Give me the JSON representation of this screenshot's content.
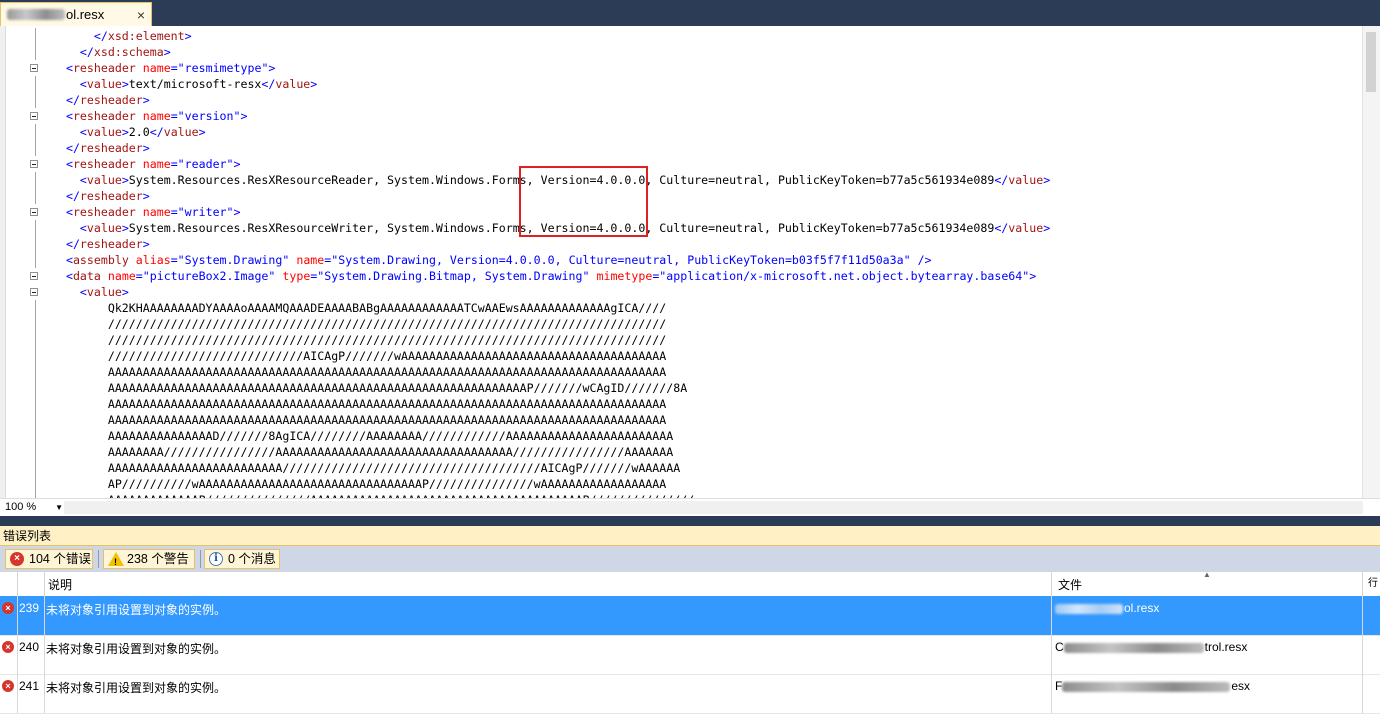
{
  "tab": {
    "filename": "ol.resx",
    "close_glyph": "×"
  },
  "editor": {
    "lines": [
      {
        "fold": false,
        "parts": [
          [
            "blue",
            "      </"
          ],
          [
            "brown",
            "xsd:element"
          ],
          [
            "blue",
            ">"
          ]
        ]
      },
      {
        "fold": false,
        "parts": [
          [
            "blue",
            "    </"
          ],
          [
            "brown",
            "xsd:schema"
          ],
          [
            "blue",
            ">"
          ]
        ]
      },
      {
        "fold": true,
        "parts": [
          [
            "blue",
            "  <"
          ],
          [
            "brown",
            "resheader"
          ],
          [
            "black",
            " "
          ],
          [
            "red",
            "name"
          ],
          [
            "blue",
            "=\""
          ],
          [
            "blue",
            "resmimetype"
          ],
          [
            "blue",
            "\">"
          ]
        ]
      },
      {
        "fold": false,
        "parts": [
          [
            "blue",
            "    <"
          ],
          [
            "brown",
            "value"
          ],
          [
            "blue",
            ">"
          ],
          [
            "black",
            "text/microsoft-resx"
          ],
          [
            "blue",
            "</"
          ],
          [
            "brown",
            "value"
          ],
          [
            "blue",
            ">"
          ]
        ]
      },
      {
        "fold": false,
        "parts": [
          [
            "blue",
            "  </"
          ],
          [
            "brown",
            "resheader"
          ],
          [
            "blue",
            ">"
          ]
        ]
      },
      {
        "fold": true,
        "parts": [
          [
            "blue",
            "  <"
          ],
          [
            "brown",
            "resheader"
          ],
          [
            "black",
            " "
          ],
          [
            "red",
            "name"
          ],
          [
            "blue",
            "=\""
          ],
          [
            "blue",
            "version"
          ],
          [
            "blue",
            "\">"
          ]
        ]
      },
      {
        "fold": false,
        "parts": [
          [
            "blue",
            "    <"
          ],
          [
            "brown",
            "value"
          ],
          [
            "blue",
            ">"
          ],
          [
            "black",
            "2.0"
          ],
          [
            "blue",
            "</"
          ],
          [
            "brown",
            "value"
          ],
          [
            "blue",
            ">"
          ]
        ]
      },
      {
        "fold": false,
        "parts": [
          [
            "blue",
            "  </"
          ],
          [
            "brown",
            "resheader"
          ],
          [
            "blue",
            ">"
          ]
        ]
      },
      {
        "fold": true,
        "parts": [
          [
            "blue",
            "  <"
          ],
          [
            "brown",
            "resheader"
          ],
          [
            "black",
            " "
          ],
          [
            "red",
            "name"
          ],
          [
            "blue",
            "=\""
          ],
          [
            "blue",
            "reader"
          ],
          [
            "blue",
            "\">"
          ]
        ]
      },
      {
        "fold": false,
        "parts": [
          [
            "blue",
            "    <"
          ],
          [
            "brown",
            "value"
          ],
          [
            "blue",
            ">"
          ],
          [
            "black",
            "System.Resources.ResXResourceReader, System.Windows.Forms, Version=4.0.0.0, Culture=neutral, PublicKeyToken=b77a5c561934e089"
          ],
          [
            "blue",
            "</"
          ],
          [
            "brown",
            "value"
          ],
          [
            "blue",
            ">"
          ]
        ]
      },
      {
        "fold": false,
        "parts": [
          [
            "blue",
            "  </"
          ],
          [
            "brown",
            "resheader"
          ],
          [
            "blue",
            ">"
          ]
        ]
      },
      {
        "fold": true,
        "parts": [
          [
            "blue",
            "  <"
          ],
          [
            "brown",
            "resheader"
          ],
          [
            "black",
            " "
          ],
          [
            "red",
            "name"
          ],
          [
            "blue",
            "=\""
          ],
          [
            "blue",
            "writer"
          ],
          [
            "blue",
            "\">"
          ]
        ]
      },
      {
        "fold": false,
        "parts": [
          [
            "blue",
            "    <"
          ],
          [
            "brown",
            "value"
          ],
          [
            "blue",
            ">"
          ],
          [
            "black",
            "System.Resources.ResXResourceWriter, System.Windows.Forms, Version=4.0.0.0, Culture=neutral, PublicKeyToken=b77a5c561934e089"
          ],
          [
            "blue",
            "</"
          ],
          [
            "brown",
            "value"
          ],
          [
            "blue",
            ">"
          ]
        ]
      },
      {
        "fold": false,
        "parts": [
          [
            "blue",
            "  </"
          ],
          [
            "brown",
            "resheader"
          ],
          [
            "blue",
            ">"
          ]
        ]
      },
      {
        "fold": false,
        "parts": [
          [
            "blue",
            "  <"
          ],
          [
            "brown",
            "assembly"
          ],
          [
            "black",
            " "
          ],
          [
            "red",
            "alias"
          ],
          [
            "blue",
            "=\"System.Drawing\""
          ],
          [
            "black",
            " "
          ],
          [
            "red",
            "name"
          ],
          [
            "blue",
            "=\"System.Drawing, Version=4.0.0.0, Culture=neutral, PublicKeyToken=b03f5f7f11d50a3a\""
          ],
          [
            "blue",
            " />"
          ]
        ]
      },
      {
        "fold": true,
        "parts": [
          [
            "blue",
            "  <"
          ],
          [
            "brown",
            "data"
          ],
          [
            "black",
            " "
          ],
          [
            "red",
            "name"
          ],
          [
            "blue",
            "=\"pictureBox2.Image\""
          ],
          [
            "black",
            " "
          ],
          [
            "red",
            "type"
          ],
          [
            "blue",
            "=\"System.Drawing.Bitmap, System.Drawing\""
          ],
          [
            "black",
            " "
          ],
          [
            "red",
            "mimetype"
          ],
          [
            "blue",
            "=\"application/x-microsoft.net.object.bytearray.base64\">"
          ]
        ]
      },
      {
        "fold": true,
        "parts": [
          [
            "blue",
            "    <"
          ],
          [
            "brown",
            "value"
          ],
          [
            "blue",
            ">"
          ]
        ]
      },
      {
        "fold": false,
        "parts": [
          [
            "black",
            "        Qk2KHAAAAAAAADYAAAAoAAAAMQAAADEAAAABABgAAAAAAAAAAAATCwAAEwsAAAAAAAAAAAAAgICA////"
          ]
        ]
      },
      {
        "fold": false,
        "parts": [
          [
            "black",
            "        ////////////////////////////////////////////////////////////////////////////////"
          ]
        ]
      },
      {
        "fold": false,
        "parts": [
          [
            "black",
            "        ////////////////////////////////////////////////////////////////////////////////"
          ]
        ]
      },
      {
        "fold": false,
        "parts": [
          [
            "black",
            "        ////////////////////////////AICAgP///////wAAAAAAAAAAAAAAAAAAAAAAAAAAAAAAAAAAAAAA"
          ]
        ]
      },
      {
        "fold": false,
        "parts": [
          [
            "black",
            "        AAAAAAAAAAAAAAAAAAAAAAAAAAAAAAAAAAAAAAAAAAAAAAAAAAAAAAAAAAAAAAAAAAAAAAAAAAAAAAAA"
          ]
        ]
      },
      {
        "fold": false,
        "parts": [
          [
            "black",
            "        AAAAAAAAAAAAAAAAAAAAAAAAAAAAAAAAAAAAAAAAAAAAAAAAAAAAAAAAAAAAP///////wCAgID///////8A"
          ]
        ]
      },
      {
        "fold": false,
        "parts": [
          [
            "black",
            "        AAAAAAAAAAAAAAAAAAAAAAAAAAAAAAAAAAAAAAAAAAAAAAAAAAAAAAAAAAAAAAAAAAAAAAAAAAAAAAAA"
          ]
        ]
      },
      {
        "fold": false,
        "parts": [
          [
            "black",
            "        AAAAAAAAAAAAAAAAAAAAAAAAAAAAAAAAAAAAAAAAAAAAAAAAAAAAAAAAAAAAAAAAAAAAAAAAAAAAAAAA"
          ]
        ]
      },
      {
        "fold": false,
        "parts": [
          [
            "black",
            "        AAAAAAAAAAAAAAAD///////8AgICA////////AAAAAAAA////////////AAAAAAAAAAAAAAAAAAAAAAAA"
          ]
        ]
      },
      {
        "fold": false,
        "parts": [
          [
            "black",
            "        AAAAAAAA////////////////AAAAAAAAAAAAAAAAAAAAAAAAAAAAAAAAAA////////////////AAAAAAA"
          ]
        ]
      },
      {
        "fold": false,
        "parts": [
          [
            "black",
            "        AAAAAAAAAAAAAAAAAAAAAAAAA/////////////////////////////////////AICAgP///////wAAAAAA"
          ]
        ]
      },
      {
        "fold": false,
        "parts": [
          [
            "black",
            "        AP//////////wAAAAAAAAAAAAAAAAAAAAAAAAAAAAAAAAP///////////////wAAAAAAAAAAAAAAAAAA"
          ]
        ]
      },
      {
        "fold": false,
        "parts": [
          [
            "black",
            "        AAAAAAAAAAAAAP///////////////AAAAAAAAAAAAAAAAAAAAAAAAAAAAAAAAAAAAAAAP///////////////"
          ]
        ]
      }
    ],
    "zoom": "100 %"
  },
  "errors": {
    "title": "错误列表",
    "filters": [
      {
        "icon": "error-icon",
        "label": "104 个错误"
      },
      {
        "icon": "warning-icon",
        "label": "238 个警告"
      },
      {
        "icon": "info-icon",
        "label": "0 个消息"
      }
    ],
    "columns": {
      "description": "说明",
      "file": "文件",
      "line": "行"
    },
    "rows": [
      {
        "num": "239",
        "desc": "未将对象引用设置到对象的实例。",
        "file_suffix": "ol.resx",
        "selected": true
      },
      {
        "num": "240",
        "desc": "未将对象引用设置到对象的实例。",
        "file_prefix": "C",
        "file_suffix": "trol.resx",
        "selected": false
      },
      {
        "num": "241",
        "desc": "未将对象引用设置到对象的实例。",
        "file_prefix": "F",
        "file_suffix": "esx",
        "selected": false
      }
    ]
  },
  "colors": {
    "selection": "#3399ff",
    "error": "#d6352b",
    "warning": "#f2c200",
    "highlight_box": "#e02020"
  }
}
